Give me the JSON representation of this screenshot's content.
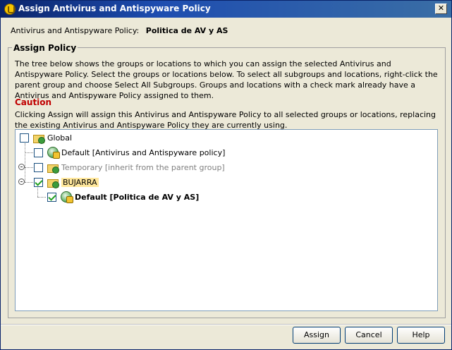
{
  "window": {
    "title": "Assign Antivirus and Antispyware Policy",
    "close_glyph": "✕"
  },
  "policy": {
    "label": "Antivirus and Antispyware Policy:",
    "value": "Politica de AV y AS"
  },
  "assign_policy": {
    "heading": "Assign Policy",
    "description": "The tree below shows the groups or locations to which you can assign the selected Antivirus and Antispyware Policy. Select the groups or locations below. To select all subgroups and locations, right-click the parent group and choose Select All Subgroups. Groups and locations with a check mark already have a Antivirus and Antispyware Policy assigned to them."
  },
  "caution": {
    "heading": "Caution",
    "text": "Clicking Assign will assign this Antivirus and Antispyware Policy to all selected groups or locations, replacing the existing Antivirus and Antispyware Policy they are currently using."
  },
  "tree": {
    "nodes": [
      {
        "label": "Global",
        "checked": false,
        "icon": "group-folder-icon"
      },
      {
        "label": "Default [Antivirus and Antispyware policy]",
        "checked": false,
        "icon": "location-icon"
      },
      {
        "label": "Temporary [inherit from the parent group]",
        "checked": false,
        "icon": "group-folder-icon"
      },
      {
        "label": "BUJARRA",
        "checked": true,
        "icon": "group-folder-icon"
      },
      {
        "label": "Default [Politica de AV y AS]",
        "checked": true,
        "icon": "location-icon"
      }
    ]
  },
  "buttons": {
    "assign": "Assign",
    "cancel": "Cancel",
    "help": "Help"
  }
}
